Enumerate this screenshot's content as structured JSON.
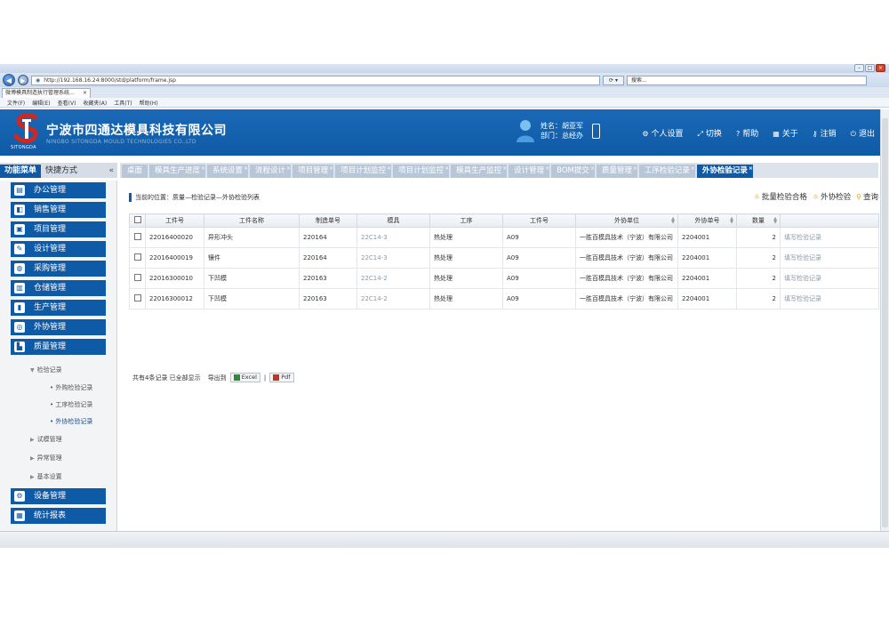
{
  "browser": {
    "address": "http://192.168.16.24:8000/std/platform/frame.jsp",
    "search_placeholder": "搜索...",
    "tab_title": "微博模具制造执行管理系统...",
    "menu": [
      "文件(F)",
      "编辑(E)",
      "查看(V)",
      "收藏夹(A)",
      "工具(T)",
      "帮助(H)"
    ]
  },
  "header": {
    "company": "宁波市四通达模具科技有限公司",
    "company_en": "NINGBO SITONGDA MOULD TECHNOLOGIES CO.,LTD",
    "logo_text": "SITONGDA",
    "user_name_line": "姓名：胡亚军",
    "user_dept_line": "部门：总经办",
    "nav": [
      {
        "icon": "gear-icon",
        "glyph": "⚙",
        "label": "个人设置"
      },
      {
        "icon": "switch-icon",
        "glyph": "⤢",
        "label": "切换"
      },
      {
        "icon": "help-icon",
        "glyph": "?",
        "label": "帮助"
      },
      {
        "icon": "about-icon",
        "glyph": "▦",
        "label": "关于"
      },
      {
        "icon": "key-icon",
        "glyph": "⚷",
        "label": "注销"
      },
      {
        "icon": "power-icon",
        "glyph": "⏻",
        "label": "退出"
      }
    ]
  },
  "sidebar": {
    "tab_active": "功能菜单",
    "tab_other": "快捷方式",
    "collapse": "«",
    "menus": [
      {
        "label": "办公管理",
        "glyph": "▤"
      },
      {
        "label": "销售管理",
        "glyph": "◧"
      },
      {
        "label": "项目管理",
        "glyph": "▣"
      },
      {
        "label": "设计管理",
        "glyph": "✎"
      },
      {
        "label": "采购管理",
        "glyph": "◍"
      },
      {
        "label": "仓储管理",
        "glyph": "▥"
      },
      {
        "label": "生产管理",
        "glyph": "▮"
      },
      {
        "label": "外协管理",
        "glyph": "◎"
      },
      {
        "label": "质量管理",
        "glyph": "▙"
      }
    ],
    "quality_sub": {
      "group": "检验记录",
      "items": [
        "外购检验记录",
        "工序检验记录",
        "外协检验记录"
      ],
      "others": [
        "试模管理",
        "异常管理",
        "基本设置"
      ]
    },
    "bottom_menus": [
      {
        "label": "设备管理",
        "glyph": "⚙"
      },
      {
        "label": "统计报表",
        "glyph": "▦"
      }
    ]
  },
  "tabs": [
    "桌面",
    "模具生产进度",
    "系统设置",
    "流程设计",
    "项目管理",
    "项目计划监控",
    "项目计划监控",
    "模具生产监控",
    "设计管理",
    "BOM提交",
    "质量管理",
    "工序检验记录",
    "外协检验记录"
  ],
  "active_tab_index": 12,
  "main": {
    "breadcrumb": "当前的位置：质量—检验记录—外协检验列表",
    "actions": [
      "批量检验合格",
      "外协检验",
      "查询"
    ],
    "columns": [
      "工件号",
      "工件名称",
      "制造单号",
      "模具",
      "工序",
      "工件号",
      "外协单位",
      "外协单号",
      "数量",
      ""
    ],
    "rows": [
      [
        "22016400020",
        "异形冲头",
        "220164",
        "22C14-3",
        "热处理",
        "A09",
        "一胜百模具技术（宁波）有限公司",
        "2204001",
        "2",
        "填写检验记录"
      ],
      [
        "22016400019",
        "镶件",
        "220164",
        "22C14-3",
        "热处理",
        "A09",
        "一胜百模具技术（宁波）有限公司",
        "2204001",
        "2",
        "填写检验记录"
      ],
      [
        "22016300010",
        "下凹模",
        "220163",
        "22C14-2",
        "热处理",
        "A09",
        "一胜百模具技术（宁波）有限公司",
        "2204001",
        "2",
        "填写检验记录"
      ],
      [
        "22016300012",
        "下凹模",
        "220163",
        "22C14-2",
        "热处理",
        "A09",
        "一胜百模具技术（宁波）有限公司",
        "2204001",
        "2",
        "填写检验记录"
      ]
    ],
    "summary": "共有4条记录 已全部显示",
    "export_label": "导出到",
    "export_excel": "Excel",
    "export_pdf": "Pdf"
  },
  "colors": {
    "brand_blue": "#0f5aa6",
    "tab_inactive": "#b8c7d8",
    "action_icon": "#e5a200",
    "logo_red": "#d0281e"
  }
}
